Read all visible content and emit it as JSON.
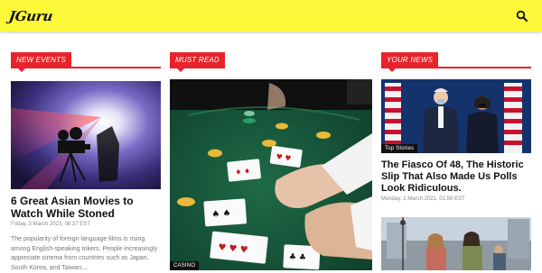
{
  "header": {
    "logo": "JGuru",
    "search_icon": "search-icon",
    "background": "#fdf93a"
  },
  "accent": "#e8232b",
  "columns": [
    {
      "tag": "NEW EVENTS",
      "article": {
        "title": "6 Great Asian Movies to Watch While Stoned",
        "date": "Friday, 3 March 2023, 08:37 EST",
        "excerpt": "The popularity of foreign language films is rising among English-speaking tokers. People increasingly appreciate cinema from countries such as Japan, South Korea, and Taiwan...."
      }
    },
    {
      "tag": "MUST READ",
      "article": {
        "category": "CASINO"
      }
    },
    {
      "tag": "YOUR NEWS",
      "article": {
        "category": "Top Stories",
        "title": "The Fiasco Of 48, The Historic Slip That Also Made Us Polls Look Ridiculous.",
        "date": "Monday, 1 March 2021, 01:56 EST"
      }
    }
  ]
}
